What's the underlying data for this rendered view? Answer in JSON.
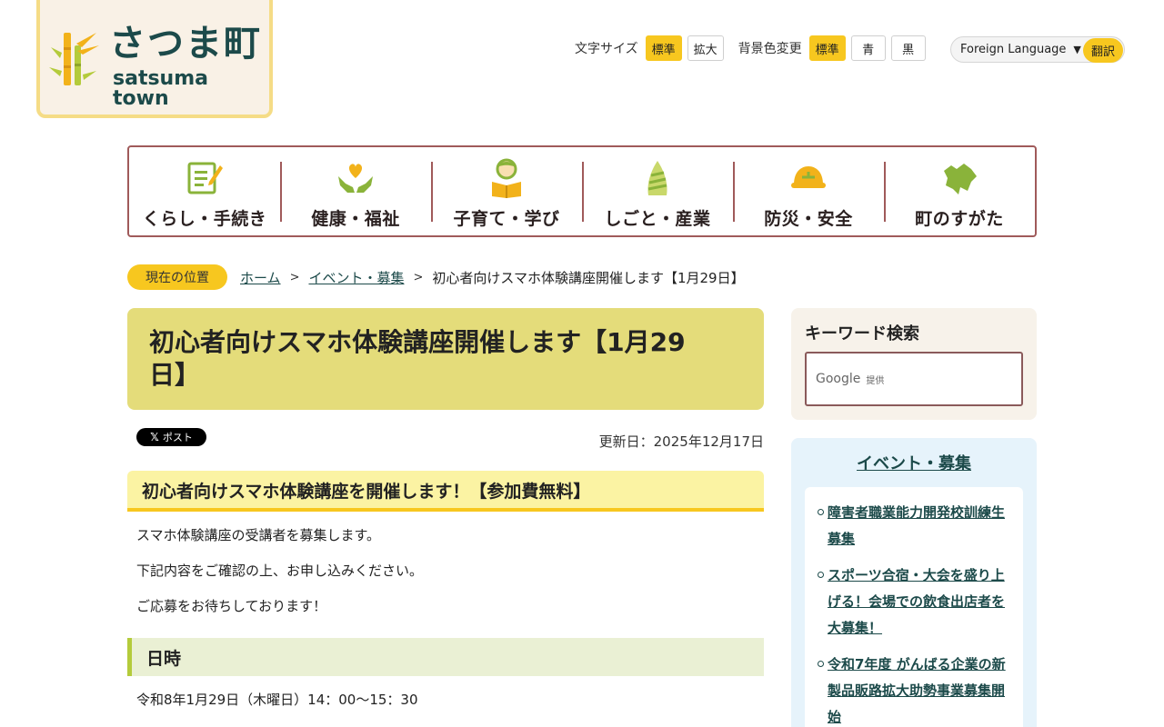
{
  "logo": {
    "name_ja": "さつま町",
    "name_en": "satsuma town"
  },
  "tools": {
    "font_size_label": "文字サイズ",
    "font_size_options": [
      "標準",
      "拡大"
    ],
    "bg_color_label": "背景色変更",
    "bg_color_options": [
      "標準",
      "青",
      "黒"
    ]
  },
  "language": {
    "selected": "Foreign Language",
    "translate_label": "翻訳"
  },
  "nav": {
    "items": [
      {
        "label": "くらし・手続き",
        "icon": "document-pen-icon"
      },
      {
        "label": "健康・福祉",
        "icon": "hands-heart-icon"
      },
      {
        "label": "子育て・学び",
        "icon": "child-book-icon"
      },
      {
        "label": "しごと・産業",
        "icon": "bamboo-shoot-icon"
      },
      {
        "label": "防災・安全",
        "icon": "helmet-icon"
      },
      {
        "label": "町のすがた",
        "icon": "town-map-icon"
      }
    ]
  },
  "breadcrumb": {
    "badge": "現在の位置",
    "items": [
      "ホーム",
      "イベント・募集"
    ],
    "current": "初心者向けスマホ体験講座開催します【1月29日】"
  },
  "article": {
    "title": "初心者向けスマホ体験講座開催します【1月29日】",
    "share_label": "ポスト",
    "updated": "更新日：2025年12月17日",
    "heading": "初心者向けスマホ体験講座を開催します！【参加費無料】",
    "paragraphs": [
      "スマホ体験講座の受講者を募集します。",
      "下記内容をご確認の上、お申し込みください。",
      "ご応募をお待ちしております！"
    ],
    "section_heading": "日時",
    "datetime": "令和8年1月29日（木曜日）14：00～15：30"
  },
  "sidebar": {
    "search_title": "キーワード検索",
    "search_brand": "Google",
    "search_provided": "提供",
    "event_title": "イベント・募集",
    "event_links": [
      "障害者職業能力開発校訓練生募集",
      "スポーツ合宿・大会を盛り上げる！会場での飲食出店者を大募集！",
      "令和7年度 がんばる企業の新製品販路拡大助勢事業募集開始"
    ]
  },
  "colors": {
    "accent_yellow": "#f7c71f",
    "title_bg": "#e4dc7a",
    "nav_border": "#a05a5a",
    "link": "#1c4a4a"
  }
}
